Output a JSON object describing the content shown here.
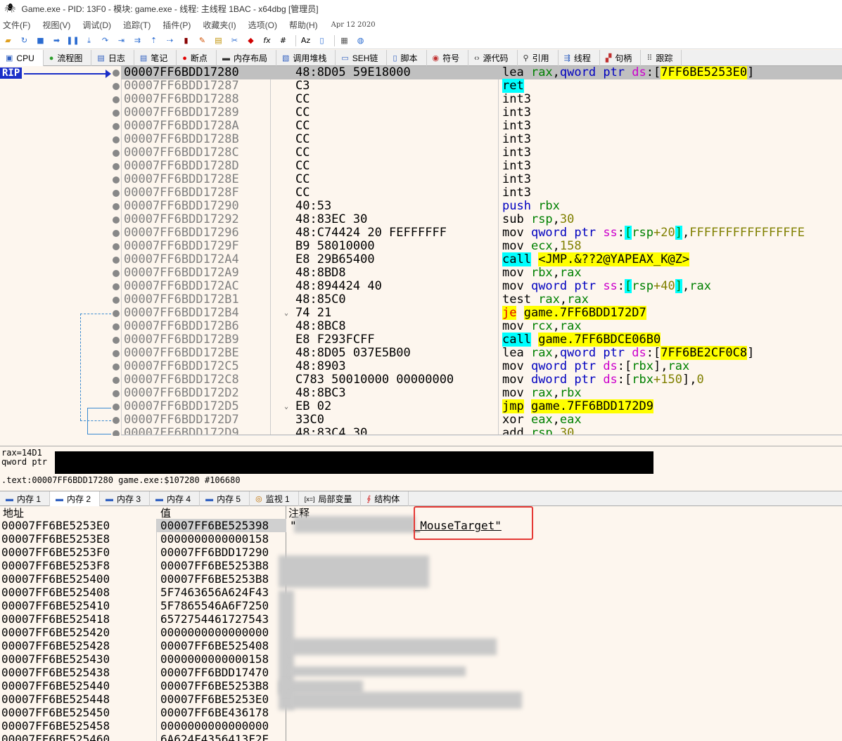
{
  "window": {
    "title": "Game.exe - PID: 13F0 - 模块: game.exe - 线程: 主线程 1BAC - x64dbg [管理员]"
  },
  "menu": {
    "items": [
      "文件(F)",
      "视图(V)",
      "调试(D)",
      "追踪(T)",
      "插件(P)",
      "收藏夹(I)",
      "选项(O)",
      "帮助(H)"
    ],
    "date": "Apr 12 2020"
  },
  "toolbar": {
    "fx": "fx",
    "hash": "#"
  },
  "tabs": [
    {
      "label": "CPU"
    },
    {
      "label": "流程图"
    },
    {
      "label": "日志"
    },
    {
      "label": "笔记"
    },
    {
      "label": "断点"
    },
    {
      "label": "内存布局"
    },
    {
      "label": "调用堆栈"
    },
    {
      "label": "SEH链"
    },
    {
      "label": "脚本"
    },
    {
      "label": "符号"
    },
    {
      "label": "源代码"
    },
    {
      "label": "引用"
    },
    {
      "label": "线程"
    },
    {
      "label": "句柄"
    },
    {
      "label": "跟踪"
    }
  ],
  "disasm": {
    "rip_label": "RIP",
    "rows": [
      {
        "addr": "00007FF6BDD17280",
        "bytes": "48:8D05 59E18000"
      },
      {
        "addr": "00007FF6BDD17287",
        "bytes": "C3"
      },
      {
        "addr": "00007FF6BDD17288",
        "bytes": "CC"
      },
      {
        "addr": "00007FF6BDD17289",
        "bytes": "CC"
      },
      {
        "addr": "00007FF6BDD1728A",
        "bytes": "CC"
      },
      {
        "addr": "00007FF6BDD1728B",
        "bytes": "CC"
      },
      {
        "addr": "00007FF6BDD1728C",
        "bytes": "CC"
      },
      {
        "addr": "00007FF6BDD1728D",
        "bytes": "CC"
      },
      {
        "addr": "00007FF6BDD1728E",
        "bytes": "CC"
      },
      {
        "addr": "00007FF6BDD1728F",
        "bytes": "CC"
      },
      {
        "addr": "00007FF6BDD17290",
        "bytes": "40:53"
      },
      {
        "addr": "00007FF6BDD17292",
        "bytes": "48:83EC 30"
      },
      {
        "addr": "00007FF6BDD17296",
        "bytes": "48:C74424 20 FEFFFFFF"
      },
      {
        "addr": "00007FF6BDD1729F",
        "bytes": "B9 58010000"
      },
      {
        "addr": "00007FF6BDD172A4",
        "bytes": "E8 29B65400"
      },
      {
        "addr": "00007FF6BDD172A9",
        "bytes": "48:8BD8"
      },
      {
        "addr": "00007FF6BDD172AC",
        "bytes": "48:894424 40"
      },
      {
        "addr": "00007FF6BDD172B1",
        "bytes": "48:85C0"
      },
      {
        "addr": "00007FF6BDD172B4",
        "bytes": "74 21"
      },
      {
        "addr": "00007FF6BDD172B6",
        "bytes": "48:8BC8"
      },
      {
        "addr": "00007FF6BDD172B9",
        "bytes": "E8 F293FCFF"
      },
      {
        "addr": "00007FF6BDD172BE",
        "bytes": "48:8D05 037E5B00"
      },
      {
        "addr": "00007FF6BDD172C5",
        "bytes": "48:8903"
      },
      {
        "addr": "00007FF6BDD172C8",
        "bytes": "C783 50010000 00000000"
      },
      {
        "addr": "00007FF6BDD172D2",
        "bytes": "48:8BC3"
      },
      {
        "addr": "00007FF6BDD172D5",
        "bytes": "EB 02"
      },
      {
        "addr": "00007FF6BDD172D7",
        "bytes": "33C0"
      },
      {
        "addr": "00007FF6BDD172D9",
        "bytes": "48:83C4 30"
      }
    ],
    "ins": {
      "r0a": "lea ",
      "r0b": "rax",
      "r0c": ",",
      "r0d": "qword ptr ",
      "r0e": "ds",
      "r0f": ":[",
      "r0g": "7FF6BE5253E0",
      "r0h": "]",
      "r1": "ret",
      "int3": "int3",
      "r10a": "push ",
      "r10b": "rbx",
      "r11a": "sub ",
      "r11b": "rsp",
      "r11c": ",",
      "r11d": "30",
      "r12a": "mov ",
      "r12b": "qword ptr ",
      "r12c": "ss",
      "r12d": ":",
      "r12e": "[",
      "r12f": "rsp",
      "r12g": "+20",
      "r12h": "]",
      "r12i": ",",
      "r12j": "FFFFFFFFFFFFFFFE",
      "r13a": "mov ",
      "r13b": "ecx",
      "r13c": ",",
      "r13d": "158",
      "r14a": "call",
      "r14b": " ",
      "r14c": "<JMP.&??2@YAPEAX_K@Z>",
      "r15a": "mov ",
      "r15b": "rbx",
      "r15c": ",",
      "r15d": "rax",
      "r16a": "mov ",
      "r16b": "qword ptr ",
      "r16c": "ss",
      "r16d": ":",
      "r16e": "[",
      "r16f": "rsp",
      "r16g": "+40",
      "r16h": "]",
      "r16i": ",",
      "r16j": "rax",
      "r17a": "test ",
      "r17b": "rax",
      "r17c": ",",
      "r17d": "rax",
      "r18a": "je",
      "r18b": " ",
      "r18c": "game.7FF6BDD172D7",
      "r19a": "mov ",
      "r19b": "rcx",
      "r19c": ",",
      "r19d": "rax",
      "r20a": "call",
      "r20b": " ",
      "r20c": "game.7FF6BDCE06B0",
      "r21a": "lea ",
      "r21b": "rax",
      "r21c": ",",
      "r21d": "qword ptr ",
      "r21e": "ds",
      "r21f": ":[",
      "r21g": "7FF6BE2CF0C8",
      "r21h": "]",
      "r22a": "mov ",
      "r22b": "qword ptr ",
      "r22c": "ds",
      "r22d": ":[",
      "r22e": "rbx",
      "r22f": "],",
      "r22g": "rax",
      "r23a": "mov ",
      "r23b": "dword ptr ",
      "r23c": "ds",
      "r23d": ":[",
      "r23e": "rbx",
      "r23f": "+150",
      "r23g": "],",
      "r23h": "0",
      "r24a": "mov ",
      "r24b": "rax",
      "r24c": ",",
      "r24d": "rbx",
      "r25a": "jmp",
      "r25b": " ",
      "r25c": "game.7FF6BDD172D9",
      "r26a": "xor ",
      "r26b": "eax",
      "r26c": ",",
      "r26d": "eax",
      "r27a": "add ",
      "r27b": "rsp",
      "r27c": ",",
      "r27d": "30"
    }
  },
  "info": {
    "line1": "rax=14D1",
    "line2": "qword ptr",
    "line3": ".text:00007FF6BDD17280 game.exe:$107280 #106680"
  },
  "memtabs": [
    {
      "label": "内存 1"
    },
    {
      "label": "内存 2"
    },
    {
      "label": "内存 3"
    },
    {
      "label": "内存 4"
    },
    {
      "label": "内存 5"
    },
    {
      "label": "监视 1"
    },
    {
      "label": "局部变量"
    },
    {
      "label": "结构体"
    }
  ],
  "dump": {
    "headers": {
      "addr": "地址",
      "value": "值",
      "comment": "注释"
    },
    "comment0": "\"",
    "comment0b": "_MouseTarget\"",
    "rows": [
      {
        "addr": "00007FF6BE5253E0",
        "value": "00007FF6BE525398"
      },
      {
        "addr": "00007FF6BE5253E8",
        "value": "0000000000000158"
      },
      {
        "addr": "00007FF6BE5253F0",
        "value": "00007FF6BDD17290"
      },
      {
        "addr": "00007FF6BE5253F8",
        "value": "00007FF6BE5253B8"
      },
      {
        "addr": "00007FF6BE525400",
        "value": "00007FF6BE5253B8"
      },
      {
        "addr": "00007FF6BE525408",
        "value": "5F7463656A624F43"
      },
      {
        "addr": "00007FF6BE525410",
        "value": "5F7865546A6F7250"
      },
      {
        "addr": "00007FF6BE525418",
        "value": "6572754461727543"
      },
      {
        "addr": "00007FF6BE525420",
        "value": "0000000000000000"
      },
      {
        "addr": "00007FF6BE525428",
        "value": "00007FF6BE525408"
      },
      {
        "addr": "00007FF6BE525430",
        "value": "0000000000000158"
      },
      {
        "addr": "00007FF6BE525438",
        "value": "00007FF6BDD17470"
      },
      {
        "addr": "00007FF6BE525440",
        "value": "00007FF6BE5253B8"
      },
      {
        "addr": "00007FF6BE525448",
        "value": "00007FF6BE5253E0"
      },
      {
        "addr": "00007FF6BE525450",
        "value": "00007FF6BE436178"
      },
      {
        "addr": "00007FF6BE525458",
        "value": "0000000000000000"
      },
      {
        "addr": "00007FF6BE525460",
        "value": "6A624F4356413F2E"
      }
    ]
  }
}
